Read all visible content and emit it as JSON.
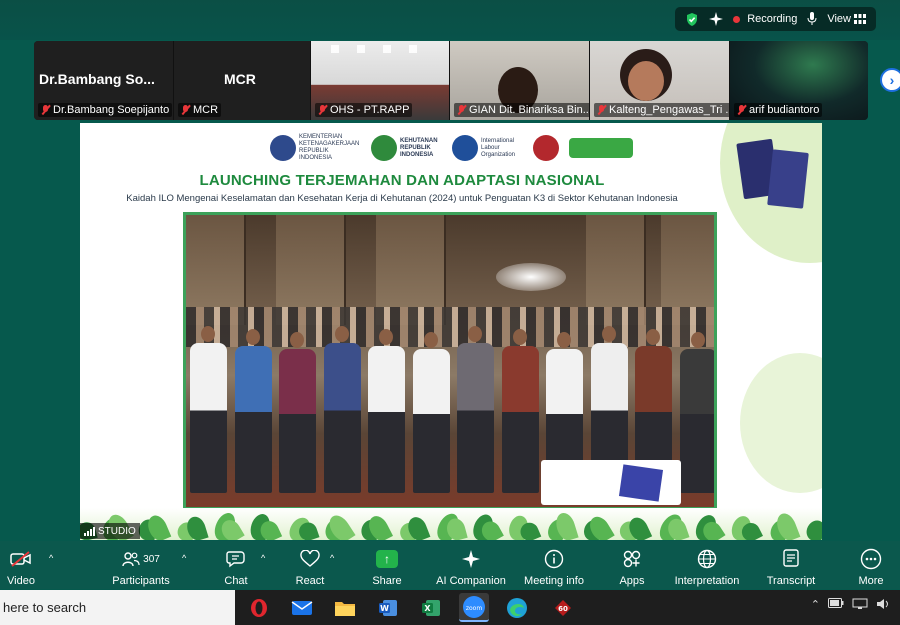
{
  "top_status": {
    "recording_label": "Recording",
    "view_label": "View"
  },
  "participants": [
    {
      "tile_name": "Dr.Bambang  So...",
      "label": "Dr.Bambang Soepijanto"
    },
    {
      "tile_name": "MCR",
      "label": "MCR"
    },
    {
      "tile_name": "",
      "label": "OHS - PT.RAPP"
    },
    {
      "tile_name": "",
      "label": "GIAN Dit. Binariksa Bin..."
    },
    {
      "tile_name": "",
      "label": "Kalteng_Pengawas_Tri ..."
    },
    {
      "tile_name": "",
      "label": "arif budiantoro"
    }
  ],
  "slide": {
    "logos": [
      {
        "text": "KEMENTERIAN KETENAGAKERJAAN REPUBLIK INDONESIA",
        "color": "#2e4a8c"
      },
      {
        "text": "KEHUTANAN REPUBLIK INDONESIA",
        "color": "#2f8a3c"
      },
      {
        "text": "International Labour Organization",
        "color": "#1f4f9a"
      },
      {
        "text": "",
        "color": "#b3282d"
      },
      {
        "text": "",
        "color": "#3aa844"
      }
    ],
    "title": "LAUNCHING TERJEMAHAN DAN ADAPTASI NASIONAL",
    "subtitle": "Kaidah ILO Mengenai Keselamatan dan Kesehatan Kerja di Kehutanan (2024) untuk Penguatan K3 di Sektor Kehutanan Indonesia",
    "studio_label": "STUDIO"
  },
  "toolbar": {
    "video": "Video",
    "participants": "Participants",
    "participant_count": "307",
    "chat": "Chat",
    "react": "React",
    "share": "Share",
    "ai_companion": "AI Companion",
    "meeting_info": "Meeting info",
    "apps": "Apps",
    "interpretation": "Interpretation",
    "transcript": "Transcript",
    "more": "More"
  },
  "taskbar": {
    "search_text": "here to search",
    "zoom_label": "zoom",
    "red_app_badge": "60"
  },
  "colors": {
    "zoom_bg": "#06594d",
    "recording_red": "#e8363a",
    "share_green": "#23b34b",
    "slide_title_green": "#1e8a3e"
  }
}
